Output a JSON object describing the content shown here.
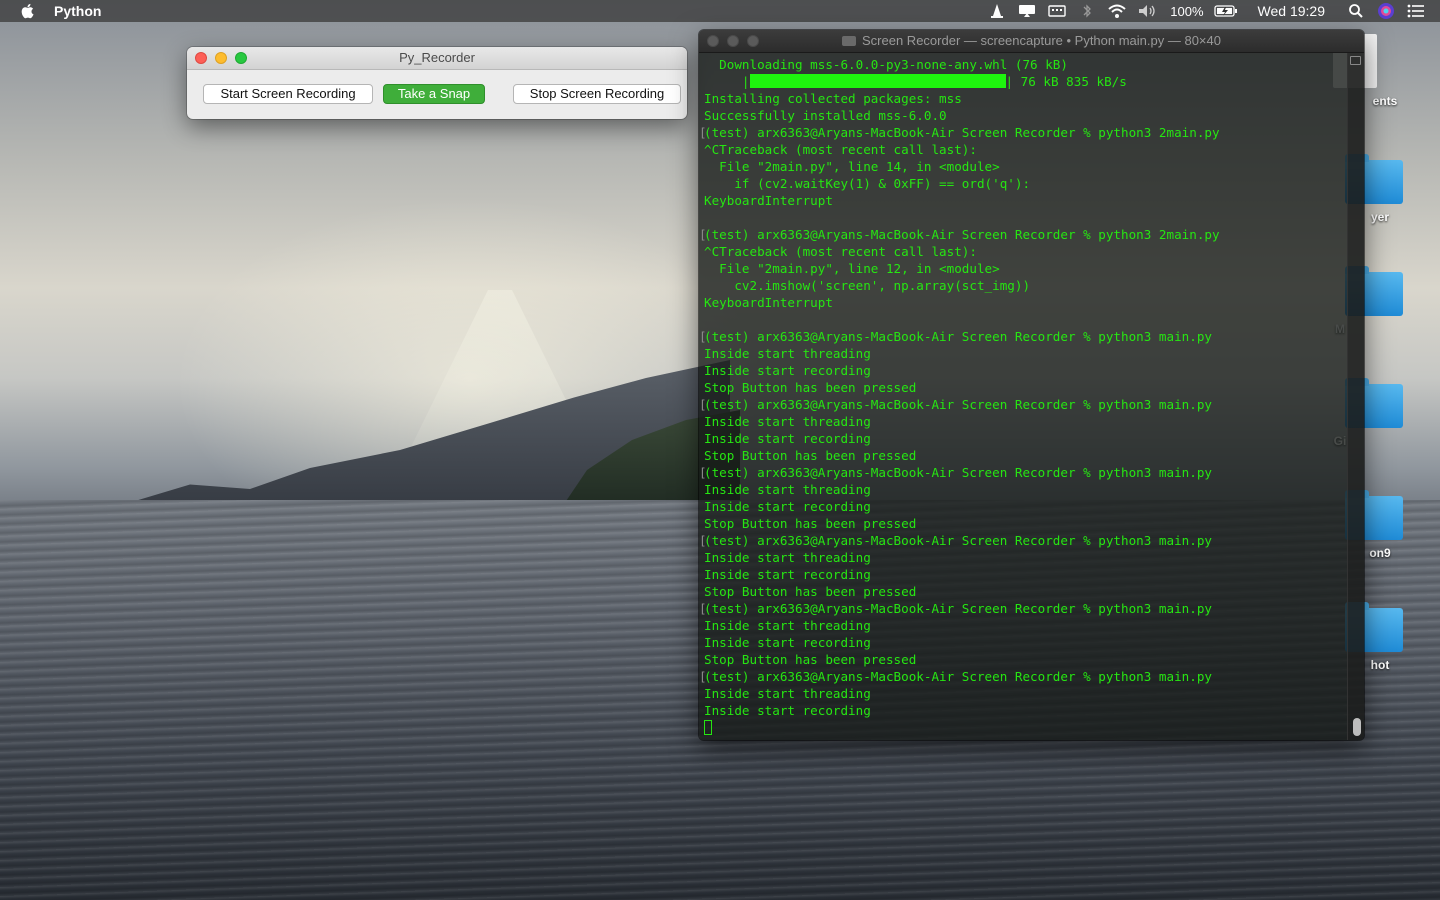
{
  "menubar": {
    "app_name": "Python",
    "battery": "100%",
    "clock": "Wed 19:29"
  },
  "py_recorder": {
    "title": "Py_Recorder",
    "buttons": {
      "start": "Start Screen Recording",
      "snap": "Take a Snap",
      "stop": "Stop Screen Recording"
    }
  },
  "terminal": {
    "title": "Screen Recorder — screencapture • Python main.py — 80×40",
    "lines": [
      "  Downloading mss-6.0.0-py3-none-any.whl (76 kB)",
      "     |████████████████████████████████| 76 kB 835 kB/s",
      "Installing collected packages: mss",
      "Successfully installed mss-6.0.0",
      "(test) arx6363@Aryans-MacBook-Air Screen Recorder % python3 2main.py",
      "^CTraceback (most recent call last):",
      "  File \"2main.py\", line 14, in <module>",
      "    if (cv2.waitKey(1) & 0xFF) == ord('q'):",
      "KeyboardInterrupt",
      "",
      "(test) arx6363@Aryans-MacBook-Air Screen Recorder % python3 2main.py",
      "^CTraceback (most recent call last):",
      "  File \"2main.py\", line 12, in <module>",
      "    cv2.imshow('screen', np.array(sct_img))",
      "KeyboardInterrupt",
      "",
      "(test) arx6363@Aryans-MacBook-Air Screen Recorder % python3 main.py",
      "Inside start threading",
      "Inside start recording",
      "Stop Button has been pressed",
      "(test) arx6363@Aryans-MacBook-Air Screen Recorder % python3 main.py",
      "Inside start threading",
      "Inside start recording",
      "Stop Button has been pressed",
      "(test) arx6363@Aryans-MacBook-Air Screen Recorder % python3 main.py",
      "Inside start threading",
      "Inside start recording",
      "Stop Button has been pressed",
      "(test) arx6363@Aryans-MacBook-Air Screen Recorder % python3 main.py",
      "Inside start threading",
      "Inside start recording",
      "Stop Button has been pressed",
      "(test) arx6363@Aryans-MacBook-Air Screen Recorder % python3 main.py",
      "Inside start threading",
      "Inside start recording",
      "Stop Button has been pressed",
      "(test) arx6363@Aryans-MacBook-Air Screen Recorder % python3 main.py",
      "Inside start threading",
      "Inside start recording"
    ]
  },
  "desktop_icons": [
    {
      "label": "ents",
      "kind": "document"
    },
    {
      "label": "yer",
      "kind": "folder"
    },
    {
      "label": "M",
      "kind": "folder"
    },
    {
      "label": "Gi",
      "kind": "folder"
    },
    {
      "label": "on9",
      "kind": "folder"
    },
    {
      "label": "hot",
      "kind": "folder"
    }
  ],
  "colors": {
    "terminal_text": "#26e612",
    "snap_button": "#3fae3a"
  }
}
